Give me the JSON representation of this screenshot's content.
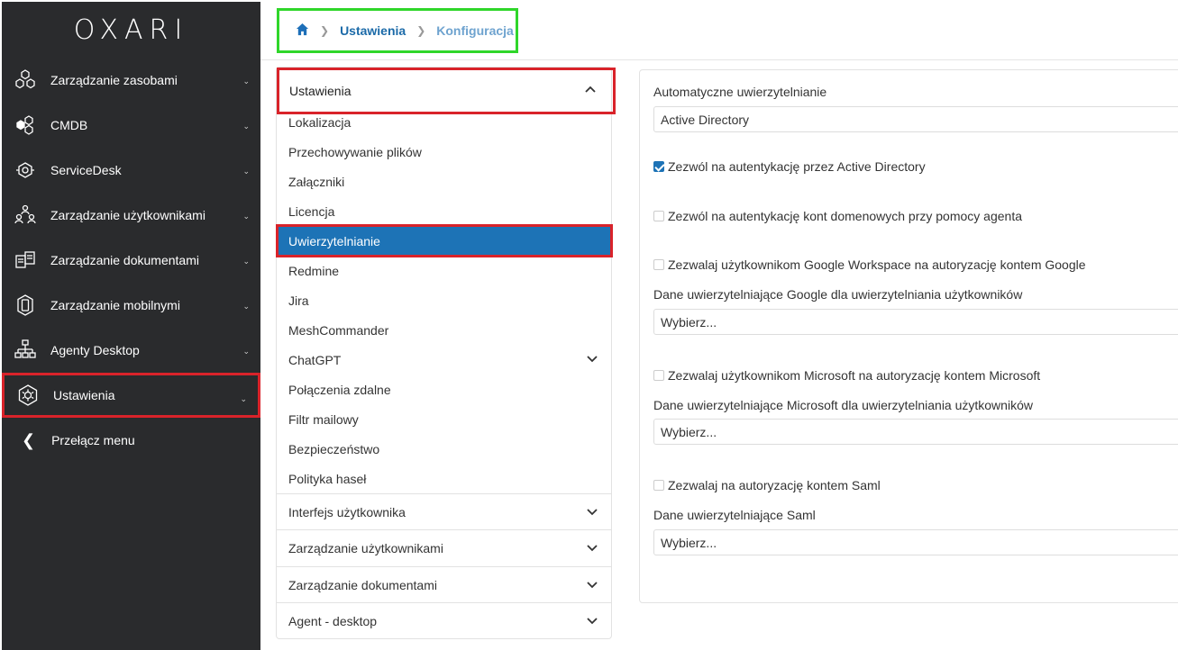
{
  "logo": "OXARI",
  "sidebar": {
    "items": [
      {
        "label": "Zarządzanie zasobami",
        "icon": "hexagons-icon"
      },
      {
        "label": "CMDB",
        "icon": "cmdb-icon"
      },
      {
        "label": "ServiceDesk",
        "icon": "headset-icon"
      },
      {
        "label": "Zarządzanie użytkownikami",
        "icon": "users-icon"
      },
      {
        "label": "Zarządzanie dokumentami",
        "icon": "documents-icon"
      },
      {
        "label": "Zarządzanie mobilnymi",
        "icon": "mobile-icon"
      },
      {
        "label": "Agenty Desktop",
        "icon": "network-icon"
      },
      {
        "label": "Ustawienia",
        "icon": "gear-icon"
      }
    ],
    "toggle_label": "Przełącz menu"
  },
  "breadcrumb": {
    "crumb1": "Ustawienia",
    "crumb2": "Konfiguracja"
  },
  "menu": {
    "header": "Ustawienia",
    "sub_items": [
      "Lokalizacja",
      "Przechowywanie plików",
      "Załączniki",
      "Licencja",
      "Uwierzytelnianie",
      "Redmine",
      "Jira",
      "MeshCommander",
      "ChatGPT",
      "Połączenia zdalne",
      "Filtr mailowy",
      "Bezpieczeństwo",
      "Polityka haseł"
    ],
    "groups": [
      "Interfejs użytkownika",
      "Zarządzanie użytkownikami",
      "Zarządzanie dokumentami",
      "Agent - desktop"
    ]
  },
  "content": {
    "auto_auth_label": "Automatyczne uwierzytelnianie",
    "auto_auth_value": "Active Directory",
    "check_ad": "Zezwól na autentykację przez Active Directory",
    "check_domain": "Zezwól na autentykację kont domenowych przy pomocy agenta",
    "check_google": "Zezwalaj użytkownikom Google Workspace na autoryzację kontem Google",
    "google_cred_label": "Dane uwierzytelniające Google dla uwierzytelniania użytkowników",
    "google_cred_value": "Wybierz...",
    "check_microsoft": "Zezwalaj użytkownikom Microsoft na autoryzację kontem Microsoft",
    "microsoft_cred_label": "Dane uwierzytelniające Microsoft dla uwierzytelniania użytkowników",
    "microsoft_cred_value": "Wybierz...",
    "check_saml": "Zezwalaj na autoryzację kontem Saml",
    "saml_cred_label": "Dane uwierzytelniające Saml",
    "saml_cred_value": "Wybierz..."
  },
  "colors": {
    "sidebar_bg": "#2a2b2d",
    "accent": "#1d73b6",
    "highlight_red": "#d9232a",
    "highlight_green": "#2fd62a"
  }
}
